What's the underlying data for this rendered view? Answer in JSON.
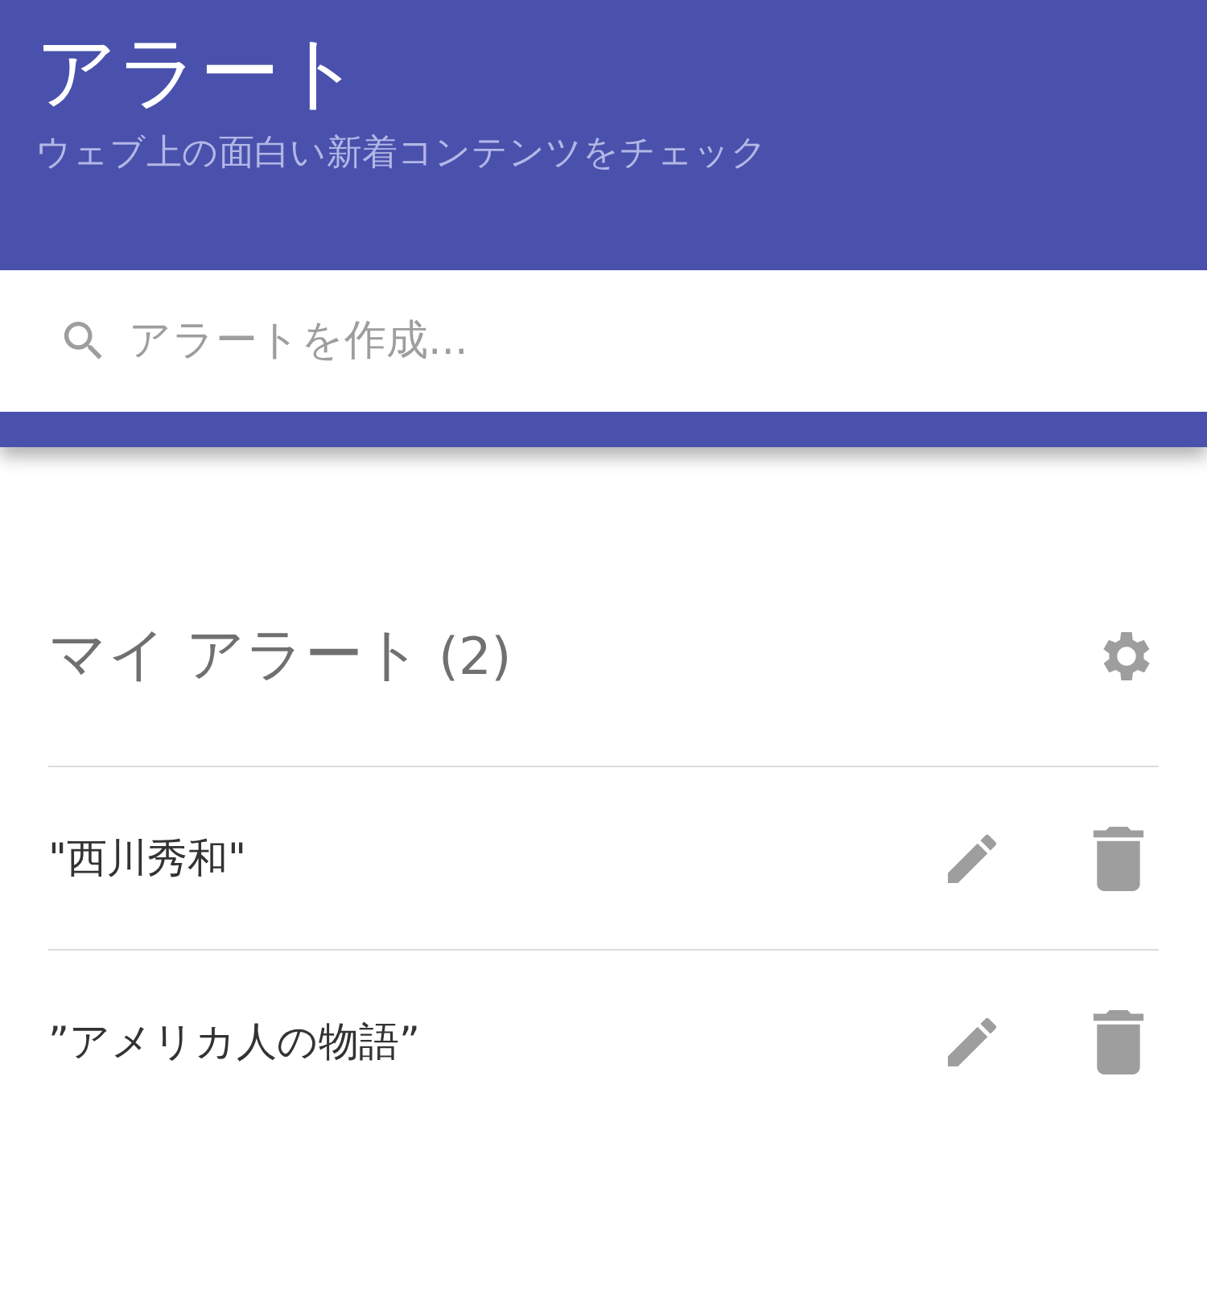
{
  "header": {
    "title": "アラート",
    "subtitle": "ウェブ上の面白い新着コンテンツをチェック"
  },
  "search": {
    "placeholder": "アラートを作成..."
  },
  "my_alerts": {
    "title": "マイ アラート",
    "count": "(2)",
    "items": [
      {
        "name": "\"西川秀和\""
      },
      {
        "name": "”アメリカ人の物語”"
      }
    ]
  }
}
